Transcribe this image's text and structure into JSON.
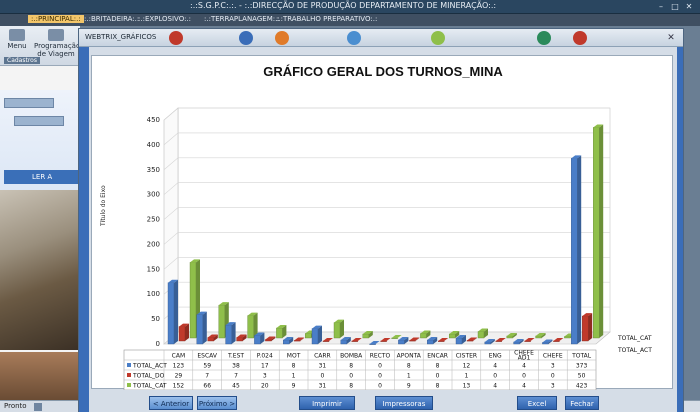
{
  "app": {
    "title": ":.:S.G.P.C:.:. - :.:DIRECÇÃO DE PRODUÇÃO  DEPARTAMENTO DE MINERAÇÃO:.:",
    "menu": [
      ":.:PRINCIPAL:.:",
      ":.:BRITADEIRA:.:",
      ":.:EXPLOSIVO:.:",
      ":.:TERRAPLANAGEM:.:",
      ":.:TRABALHO PREPARATIVO:.:"
    ],
    "ribbon": {
      "menu_label": "Menu",
      "program_label": "Programação de Viagem",
      "group_label": "Cadastros"
    },
    "left_button": "LER A",
    "status": "Pronto"
  },
  "dialog": {
    "title": "WEBTRIX_GRÁFICOS",
    "buttons": {
      "prev": "< Anterior",
      "next": "Próximo >",
      "print": "Imprimir",
      "printers": "Impressoras",
      "excel": "Excel",
      "close": "Fechar"
    }
  },
  "colors": {
    "act": "#4a7ec8",
    "do": "#c0392b",
    "cat": "#8fbf4a",
    "accent": "#3a6db8"
  },
  "chart_data": {
    "type": "bar",
    "title": "GRÁFICO GERAL DOS TURNOS_MINA",
    "ylabel": "Título do Eixo",
    "ylim": [
      0,
      450
    ],
    "yticks": [
      0,
      50,
      100,
      150,
      200,
      250,
      300,
      350,
      400,
      450
    ],
    "categories": [
      "CAM",
      "ESCAV",
      "T.EST",
      "P.024",
      "MOT",
      "CARR",
      "BOMBA",
      "RECTO",
      "APONTA",
      "ENCAR",
      "CISTER",
      "ENG",
      "CHEFE AD1",
      "CHEFE",
      "TOTAL"
    ],
    "series": [
      {
        "name": "TOTAL_ACT",
        "values": [
          123,
          59,
          38,
          17,
          8,
          31,
          8,
          0,
          8,
          8,
          12,
          4,
          4,
          3,
          373
        ]
      },
      {
        "name": "TOTAL_DO",
        "values": [
          29,
          7,
          7,
          3,
          1,
          0,
          0,
          0,
          1,
          0,
          1,
          0,
          0,
          0,
          50
        ]
      },
      {
        "name": "TOTAL_CAT",
        "values": [
          152,
          66,
          45,
          20,
          9,
          31,
          8,
          0,
          9,
          8,
          13,
          4,
          4,
          3,
          423
        ]
      }
    ],
    "side_labels": [
      "TOTAL_CAT",
      "TOTAL_ACT"
    ]
  }
}
